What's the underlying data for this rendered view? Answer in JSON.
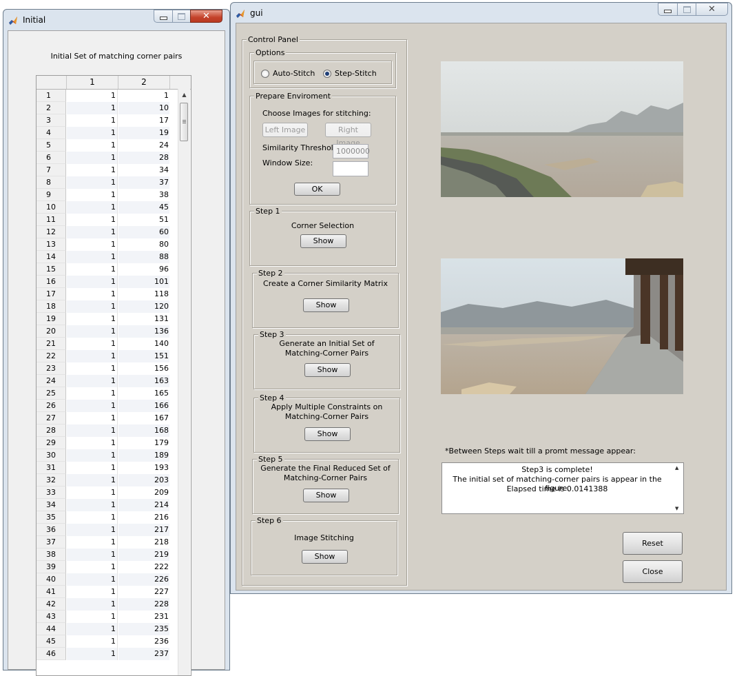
{
  "initial_window": {
    "title": "Initial",
    "table_title": "Initial Set of matching corner pairs",
    "columns": [
      "1",
      "2"
    ],
    "rows": [
      [
        1,
        1,
        1
      ],
      [
        2,
        1,
        10
      ],
      [
        3,
        1,
        17
      ],
      [
        4,
        1,
        19
      ],
      [
        5,
        1,
        24
      ],
      [
        6,
        1,
        28
      ],
      [
        7,
        1,
        34
      ],
      [
        8,
        1,
        37
      ],
      [
        9,
        1,
        38
      ],
      [
        10,
        1,
        45
      ],
      [
        11,
        1,
        51
      ],
      [
        12,
        1,
        60
      ],
      [
        13,
        1,
        80
      ],
      [
        14,
        1,
        88
      ],
      [
        15,
        1,
        96
      ],
      [
        16,
        1,
        101
      ],
      [
        17,
        1,
        118
      ],
      [
        18,
        1,
        120
      ],
      [
        19,
        1,
        131
      ],
      [
        20,
        1,
        136
      ],
      [
        21,
        1,
        140
      ],
      [
        22,
        1,
        151
      ],
      [
        23,
        1,
        156
      ],
      [
        24,
        1,
        163
      ],
      [
        25,
        1,
        165
      ],
      [
        26,
        1,
        166
      ],
      [
        27,
        1,
        167
      ],
      [
        28,
        1,
        168
      ],
      [
        29,
        1,
        179
      ],
      [
        30,
        1,
        189
      ],
      [
        31,
        1,
        193
      ],
      [
        32,
        1,
        203
      ],
      [
        33,
        1,
        209
      ],
      [
        34,
        1,
        214
      ],
      [
        35,
        1,
        216
      ],
      [
        36,
        1,
        217
      ],
      [
        37,
        1,
        218
      ],
      [
        38,
        1,
        219
      ],
      [
        39,
        1,
        222
      ],
      [
        40,
        1,
        226
      ],
      [
        41,
        1,
        227
      ],
      [
        42,
        1,
        228
      ],
      [
        43,
        1,
        231
      ],
      [
        44,
        1,
        235
      ],
      [
        45,
        1,
        236
      ],
      [
        46,
        1,
        237
      ]
    ],
    "window_buttons": {
      "minimize": "minimize-icon",
      "maximize": "maximize-icon",
      "close": "close-icon"
    }
  },
  "gui_window": {
    "title": "gui",
    "control_panel": {
      "legend": "Control Panel",
      "options": {
        "legend": "Options",
        "auto_stitch": "Auto-Stitch",
        "step_stitch": "Step-Stitch",
        "selected": "Step-Stitch"
      },
      "prepare": {
        "legend": "Prepare Enviroment",
        "choose_label": "Choose Images for stitching:",
        "left_image": "Left Image",
        "right_image": "Right Image",
        "threshold_label": "Similarity Threshold:",
        "threshold_value": "1000000",
        "window_size_label": "Window Size:",
        "window_size_value": "",
        "ok": "OK"
      },
      "steps": [
        {
          "legend": "Step 1",
          "text": "Corner Selection",
          "button": "Show"
        },
        {
          "legend": "Step 2",
          "text": "Create a Corner Similarity Matrix",
          "button": "Show"
        },
        {
          "legend": "Step 3",
          "text": "Generate an Initial Set of\nMatching-Corner Pairs",
          "button": "Show"
        },
        {
          "legend": "Step 4",
          "text": "Apply Multiple Constraints on\nMatching-Corner Pairs",
          "button": "Show"
        },
        {
          "legend": "Step 5",
          "text": "Generate the Final Reduced Set of\nMatching-Corner Pairs",
          "button": "Show"
        },
        {
          "legend": "Step 6",
          "text": "Image Stitching",
          "button": "Show"
        }
      ]
    },
    "note": "*Between Steps wait till a promt message appear:",
    "messages": [
      "Step3 is complete!",
      "The initial set of matching-corner pairs is appear in the figure.",
      "Elapsed time is 0.0141388"
    ],
    "reset": "Reset",
    "close": "Close"
  },
  "colors": {
    "panel_bg": "#d4d0c8",
    "titlebar_bg": "#dbe4ee",
    "close_button": "#c4432b"
  }
}
